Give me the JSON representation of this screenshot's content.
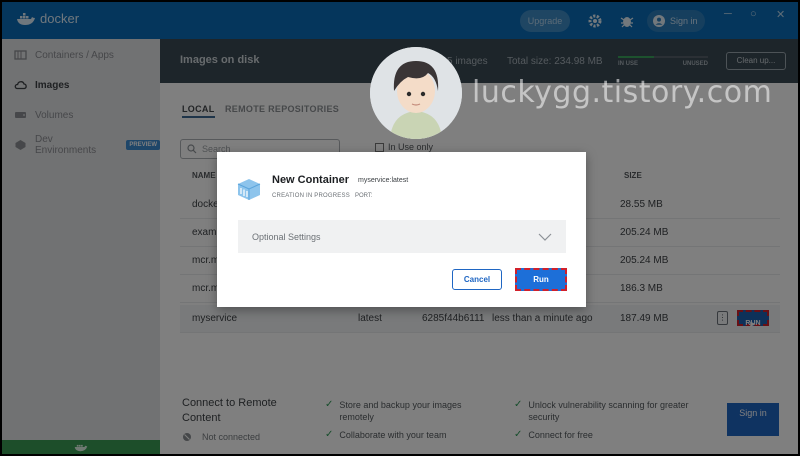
{
  "app": {
    "logo_text": "docker",
    "upgrade_label": "Upgrade",
    "signin_label": "Sign in"
  },
  "sidebar": {
    "items": [
      {
        "label": "Containers / Apps",
        "icon": "container-icon"
      },
      {
        "label": "Images",
        "icon": "cloud-icon"
      },
      {
        "label": "Volumes",
        "icon": "volume-icon"
      },
      {
        "label": "Dev Environments",
        "icon": "dev-env-icon",
        "badge": "PREVIEW"
      }
    ],
    "active": "Images"
  },
  "header": {
    "title": "Images on disk",
    "count": "5 images",
    "total_size": "Total size: 234.98 MB",
    "in_use_label": "IN USE",
    "unused_label": "UNUSED",
    "cleanup_label": "Clean up..."
  },
  "tabs": {
    "local": "LOCAL",
    "remote": "REMOTE REPOSITORIES"
  },
  "search": {
    "placeholder": "Search"
  },
  "in_use_only": "In Use only",
  "table": {
    "headers": {
      "name": "NAME",
      "size": "SIZE"
    },
    "rows": [
      {
        "name": "docke",
        "size": "28.55 MB"
      },
      {
        "name": "exam",
        "size": "205.24 MB"
      },
      {
        "name": "mcr.m",
        "size": "205.24 MB"
      },
      {
        "name": "mcr.m",
        "size": "186.3 MB"
      },
      {
        "name": "myservice",
        "tag": "latest",
        "image_id": "6285f44b6111",
        "created": "less than a minute ago",
        "size": "187.49 MB",
        "run_label": "RUN"
      }
    ]
  },
  "remote": {
    "title": "Connect to Remote Content",
    "status": "Not connected",
    "features": [
      "Store and backup your images remotely",
      "Collaborate with your team",
      "Unlock vulnerability scanning for greater security",
      "Connect for free"
    ],
    "signin_label": "Sign in"
  },
  "dialog": {
    "title": "New Container",
    "image_tag": "myservice:latest",
    "status": "CREATION IN PROGRESS",
    "port_label": "PORT:",
    "optional_settings": "Optional Settings",
    "cancel_label": "Cancel",
    "run_label": "Run"
  },
  "watermark": {
    "text": "luckygg.tistory.com"
  },
  "colors": {
    "topbar": "#0a6db8",
    "header": "#3b4a54",
    "sidebar": "#e3e4e6",
    "primary": "#1d6fd8",
    "highlight_border": "#d1202b",
    "in_use": "#3aa55c"
  }
}
